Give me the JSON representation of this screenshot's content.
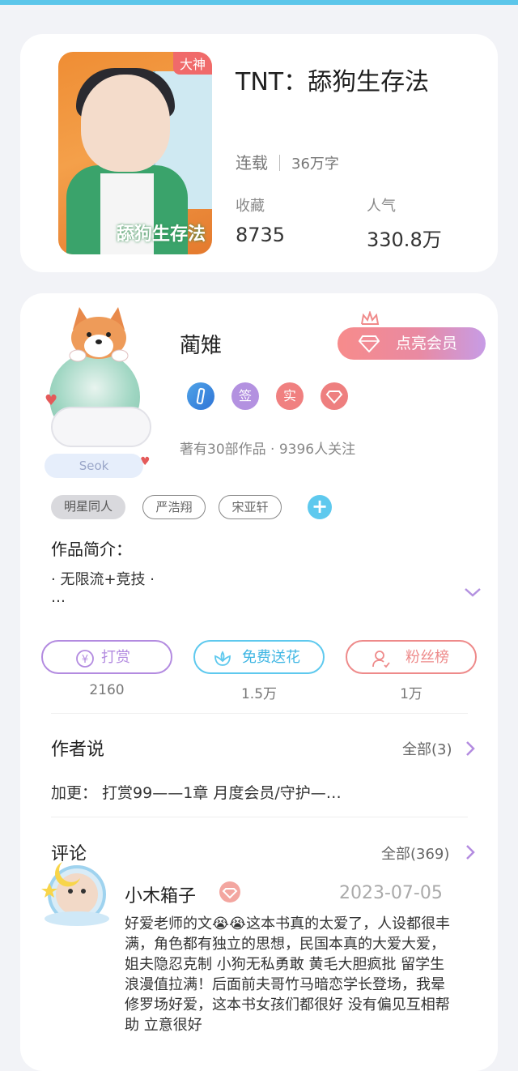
{
  "book": {
    "cover_badge": "大神",
    "cover_title": "舔狗生存法",
    "title": "TNT：舔狗生存法",
    "status": "连载",
    "word_count": "36万字",
    "favorites_label": "收藏",
    "favorites_value": "8735",
    "popularity_label": "人气",
    "popularity_value": "330.8万"
  },
  "author": {
    "name": "蔺雉",
    "avatar_tag": "Seok",
    "vip_button": "点亮会员",
    "badges": [
      "",
      "签",
      "实",
      ""
    ],
    "works_info": "著有30部作品 · 9396人关注"
  },
  "tags": [
    "明星同人",
    "严浩翔",
    "宋亚轩"
  ],
  "intro": {
    "heading": "作品简介：",
    "line1": "· 无限流+竞技 ·",
    "line2": "…"
  },
  "actions": [
    {
      "label": "打赏",
      "count": "2160",
      "color": "#b38be0"
    },
    {
      "label": "免费送花",
      "count": "1.5万",
      "color": "#5ec9ee"
    },
    {
      "label": "粉丝榜",
      "count": "1万",
      "color": "#ee8a8a"
    }
  ],
  "author_say": {
    "heading": "作者说",
    "more": "全部(3)",
    "text": "加更：  打赏99——1章 月度会员/守护—…"
  },
  "comments": {
    "heading": "评论",
    "more": "全部(369)",
    "items": [
      {
        "user": "小木箱子",
        "date": "2023-07-05",
        "text": "好爱老师的文😭😭这本书真的太爱了，人设都很丰满，角色都有独立的思想，民国本真的大爱大爱，姐夫隐忍克制 小狗无私勇敢 黄毛大胆疯批 留学生浪漫值拉满！后面前夫哥竹马暗恋学长登场，我晕 修罗场好爱，这本书女孩们都很好 没有偏见互相帮助 立意很好"
      }
    ]
  },
  "colors": {
    "accent_blue": "#5ec9ee",
    "accent_purple": "#b38be0",
    "accent_red": "#ee8a8a"
  }
}
